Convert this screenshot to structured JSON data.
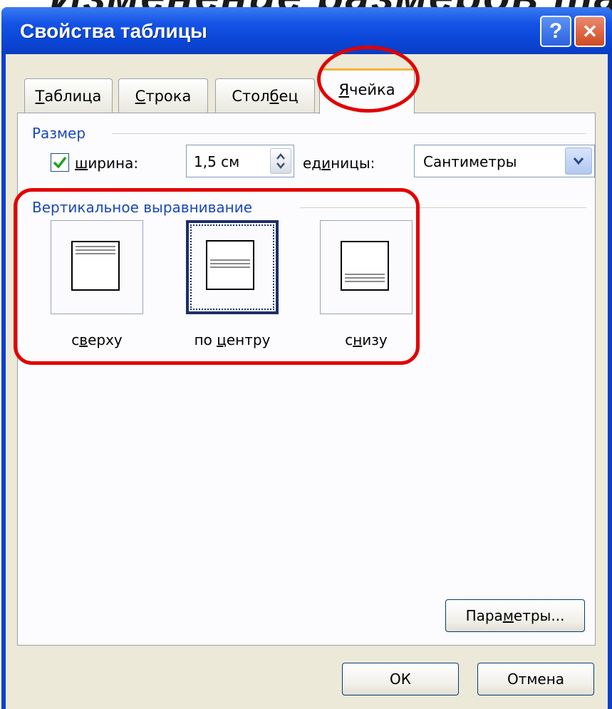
{
  "background_heading": "Изменение размеров таблицы",
  "window": {
    "title": "Свойства таблицы",
    "help_label": "?",
    "close_label": "✕"
  },
  "tabs": [
    {
      "pre": "",
      "u": "Т",
      "post": "аблица"
    },
    {
      "pre": "",
      "u": "С",
      "post": "трока"
    },
    {
      "pre": "Стол",
      "u": "б",
      "post": "ец"
    },
    {
      "pre": "",
      "u": "Я",
      "post": "чейка"
    }
  ],
  "size_group": {
    "title": "Размер",
    "width_checked": true,
    "width_label": {
      "pre": "",
      "u": "ш",
      "post": "ирина:"
    },
    "width_value": "1,5 см",
    "units_label": {
      "pre": "ед",
      "u": "и",
      "post": "ницы:"
    },
    "units_value": "Сантиметры"
  },
  "valign_group": {
    "title": "Вертикальное выравнивание",
    "options": [
      {
        "pre": "с",
        "u": "в",
        "post": "ерху",
        "selected": false
      },
      {
        "pre": "по ",
        "u": "ц",
        "post": "ентру",
        "selected": true
      },
      {
        "pre": "с",
        "u": "н",
        "post": "изу",
        "selected": false
      }
    ]
  },
  "buttons": {
    "params": {
      "pre": "Пара",
      "u": "м",
      "post": "етры..."
    },
    "ok": "ОК",
    "cancel": "Отмена"
  },
  "colors": {
    "title_bar": "#0a47d8",
    "annotation": "#e20000",
    "group_title": "#1a48b8",
    "tab_highlight": "#f3b23a",
    "dialog_face": "#ece9d8"
  },
  "icons": {
    "help": "question-mark",
    "close": "x-cross",
    "checkbox": "checkmark",
    "spin": "up-down-arrows",
    "dropdown": "chevron-down"
  }
}
